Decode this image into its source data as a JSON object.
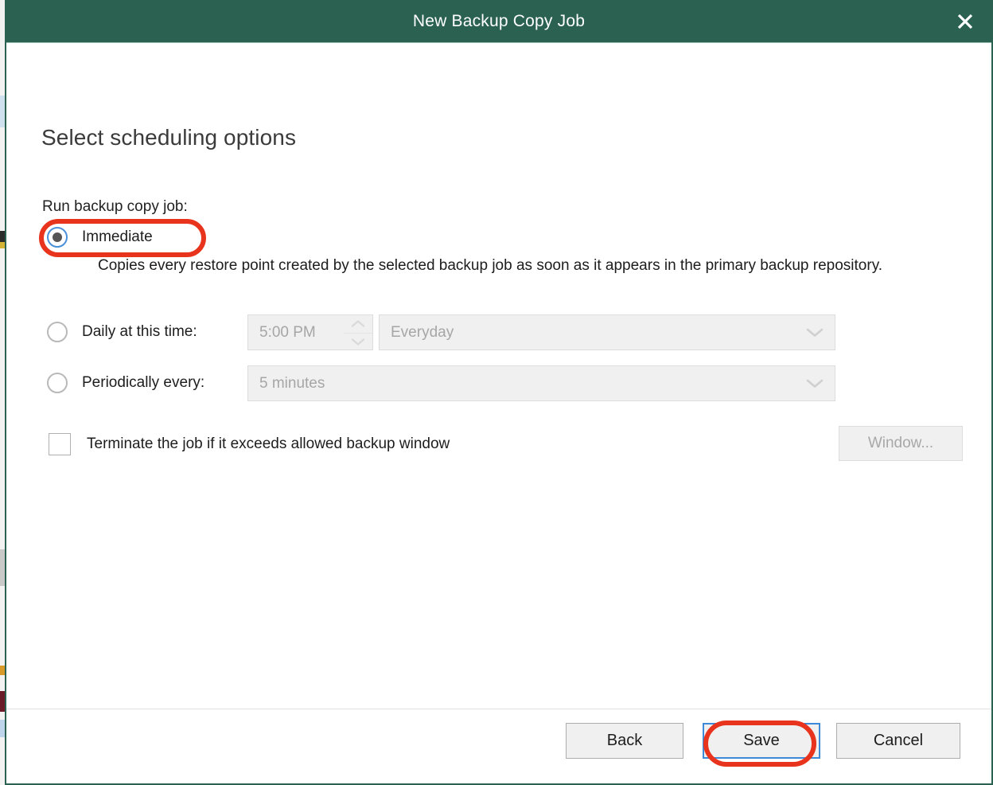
{
  "window": {
    "title": "New Backup Copy Job",
    "close_icon": "close-x-icon",
    "accent_color": "#2a6151"
  },
  "page": {
    "heading": "Select scheduling options",
    "group_label": "Run backup copy job:"
  },
  "schedule": {
    "selected": "immediate",
    "options": [
      {
        "id": "immediate",
        "label": "Immediate",
        "selected": true,
        "description": "Copies every restore point created by the selected backup job as soon as it appears in the primary backup repository."
      },
      {
        "id": "daily",
        "label": "Daily at this time:",
        "selected": false,
        "time_value": "5:00 PM",
        "days_value": "Everyday",
        "disabled": true
      },
      {
        "id": "periodically",
        "label": "Periodically every:",
        "selected": false,
        "interval_value": "5 minutes",
        "disabled": true
      }
    ]
  },
  "backup_window": {
    "checkbox_label": "Terminate the job if it exceeds allowed backup window",
    "checked": false,
    "button_label": "Window...",
    "button_disabled": true
  },
  "footer": {
    "back_label": "Back",
    "save_label": "Save",
    "cancel_label": "Cancel",
    "focused_button": "Save"
  },
  "annotations": {
    "color": "#e8341c",
    "targets": [
      "Immediate",
      "Save"
    ]
  }
}
